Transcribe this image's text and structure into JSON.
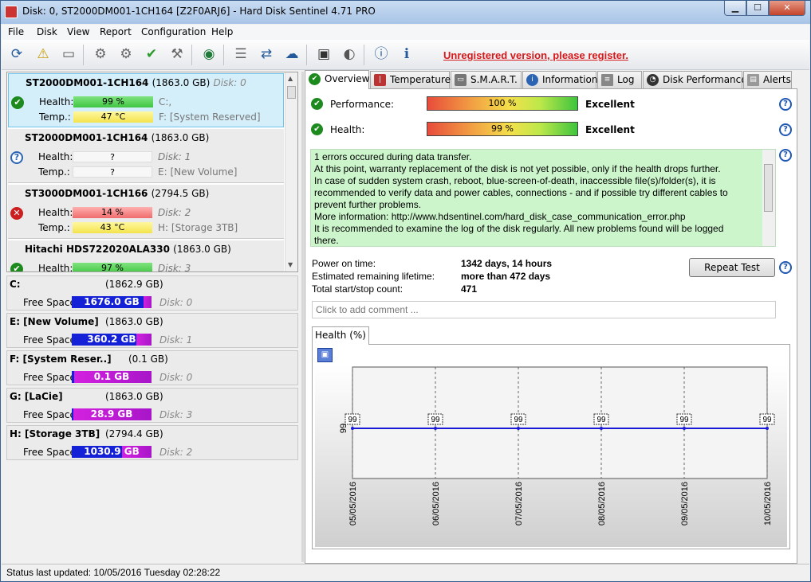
{
  "window": {
    "title": "Disk: 0, ST2000DM001-1CH164 [Z2F0ARJ6]  -  Hard Disk Sentinel 4.71 PRO",
    "minimize": "▁",
    "maximize": "☐",
    "close": "✕"
  },
  "menu": [
    "File",
    "Disk",
    "View",
    "Report",
    "Configuration",
    "Help"
  ],
  "toolbar": {
    "icons": [
      "refresh-icon",
      "warning-icon",
      "disk-icon",
      "hdd-test-icon",
      "hdd-test2-icon",
      "hdd-ok-icon",
      "hdd-tool-icon",
      "globe-icon",
      "report-icon",
      "sync-icon",
      "network-icon",
      "monitor-icon",
      "speaker-icon",
      "help-icon",
      "info-icon"
    ],
    "unregistered": "Unregistered version, please register."
  },
  "disks": [
    {
      "name": "ST2000DM001-1CH164",
      "size": "(1863.0 GB)",
      "disk": "Disk: 0",
      "health": "99 %",
      "temp": "47 °C",
      "health_level": "green",
      "temp_level": "yellow",
      "extra1": "C:,",
      "extra2": "F: [System Reserved]",
      "status": "ok"
    },
    {
      "name": "ST2000DM001-1CH164",
      "size": "(1863.0 GB)",
      "disk": "",
      "health": "?",
      "temp": "?",
      "health_level": "empty",
      "temp_level": "empty",
      "extra1": "Disk: 1",
      "extra2": "E: [New Volume]",
      "status": "q"
    },
    {
      "name": "ST3000DM001-1CH166",
      "size": "(2794.5 GB)",
      "disk": "",
      "health": "14 %",
      "temp": "43 °C",
      "health_level": "red",
      "temp_level": "yellow",
      "extra1": "Disk: 2",
      "extra2": "H: [Storage 3TB]",
      "status": "x"
    },
    {
      "name": "Hitachi HDS722020ALA330",
      "size": "(1863.0 GB)",
      "disk": "",
      "health": "97 %",
      "temp": "",
      "health_level": "green",
      "temp_level": "",
      "extra1": "Disk: 3",
      "extra2": "",
      "status": "ok"
    }
  ],
  "labels": {
    "health": "Health:",
    "temp": "Temp.:",
    "free_space": "Free Space"
  },
  "volumes": [
    {
      "name": "C:",
      "size": "(1862.9 GB)",
      "free": "1676.0 GB",
      "disk": "Disk: 0",
      "free_fraction": 0.1
    },
    {
      "name": "E: [New Volume]",
      "size": "(1863.0 GB)",
      "free": "360.2 GB",
      "disk": "Disk: 1",
      "free_fraction": 0.19
    },
    {
      "name": "F: [System Reser..]",
      "size": "(0.1 GB)",
      "free": "0.1 GB",
      "disk": "Disk: 0",
      "free_fraction": 0.97
    },
    {
      "name": "G: [LaCie]",
      "size": "(1863.0 GB)",
      "free": "28.9 GB",
      "disk": "Disk: 3",
      "free_fraction": 0.985
    },
    {
      "name": "H: [Storage 3TB]",
      "size": "(2794.4 GB)",
      "free": "1030.9 GB",
      "disk": "Disk: 2",
      "free_fraction": 0.37
    }
  ],
  "tabs": [
    "Overview",
    "Temperature",
    "S.M.A.R.T.",
    "Information",
    "Log",
    "Disk Performance",
    "Alerts"
  ],
  "overview": {
    "performance_label": "Performance:",
    "performance_value": "100 %",
    "performance_text": "Excellent",
    "health_label": "Health:",
    "health_value": "99 %",
    "health_text": "Excellent",
    "message_lines": [
      "1 errors occured during data transfer.",
      "At this point, warranty replacement of the disk is not yet possible, only if the health drops further.",
      "In case of sudden system crash, reboot, blue-screen-of-death, inaccessible file(s)/folder(s), it is",
      "recommended to verify data and power cables, connections - and if possible try different cables to",
      "prevent further problems.",
      "More information: http://www.hdsentinel.com/hard_disk_case_communication_error.php",
      "It is recommended to examine the log of the disk regularly. All new problems found will be logged",
      "there."
    ],
    "power_on_label": "Power on time:",
    "power_on_value": "1342 days, 14 hours",
    "lifetime_label": "Estimated remaining lifetime:",
    "lifetime_value": "more than 472 days",
    "startstop_label": "Total start/stop count:",
    "startstop_value": "471",
    "repeat_button": "Repeat Test",
    "comment_placeholder": "Click to add comment ...",
    "health_tab": "Health (%)"
  },
  "chart_data": {
    "type": "line",
    "x": [
      "05/05/2016",
      "06/05/2016",
      "07/05/2016",
      "08/05/2016",
      "09/05/2016",
      "10/05/2016"
    ],
    "series": [
      {
        "values": [
          99,
          99,
          99,
          99,
          99,
          99
        ]
      }
    ],
    "ytick": "99",
    "color": "#1a1ad6"
  },
  "status": "Status last updated: 10/05/2016 Tuesday 02:28:22"
}
